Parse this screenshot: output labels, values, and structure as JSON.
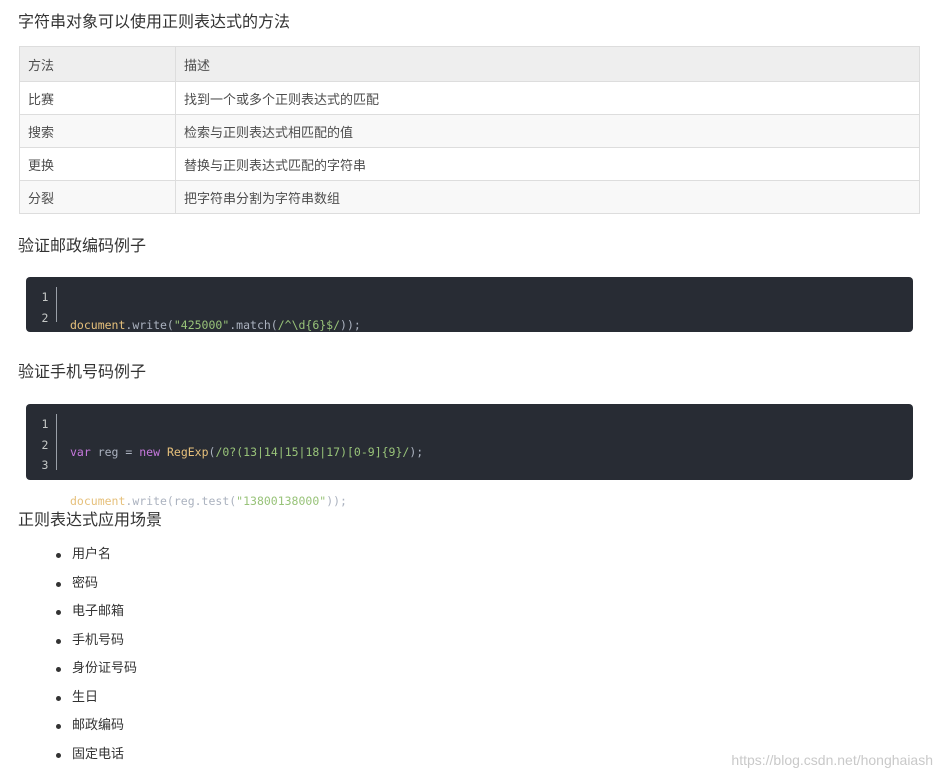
{
  "section1": {
    "title": "字符串对象可以使用正则表达式的方法",
    "table": {
      "headers": [
        "方法",
        "描述"
      ],
      "rows": [
        [
          "比赛",
          "找到一个或多个正则表达式的匹配"
        ],
        [
          "搜索",
          "检索与正则表达式相匹配的值"
        ],
        [
          "更换",
          "替换与正则表达式匹配的字符串"
        ],
        [
          "分裂",
          "把字符串分割为字符串数组"
        ]
      ]
    }
  },
  "section2": {
    "title": "验证邮政编码例子",
    "line_numbers": [
      "1",
      "2"
    ],
    "code_lines": [
      "document.write(\"425000\".match(/^\\d{6}$/));",
      ""
    ]
  },
  "section3": {
    "title": "验证手机号码例子",
    "line_numbers": [
      "1",
      "2",
      "3"
    ],
    "code_lines": [
      "var reg = new RegExp(/0?(13|14|15|18|17)[0-9]{9}/);",
      "document.write(reg.test(\"13800138000\"));",
      ""
    ]
  },
  "section4": {
    "title": "正则表达式应用场景",
    "items": [
      "用户名",
      "密码",
      "电子邮箱",
      "手机号码",
      "身份证号码",
      "生日",
      "邮政编码",
      "固定电话"
    ]
  },
  "watermark": "https://blog.csdn.net/honghaiash",
  "colors": {
    "code_background": "#282c34",
    "keyword": "#c678dd",
    "object": "#e6c07b",
    "string": "#98c379",
    "table_header_bg": "#eeeeee",
    "table_border": "#dddddd"
  }
}
